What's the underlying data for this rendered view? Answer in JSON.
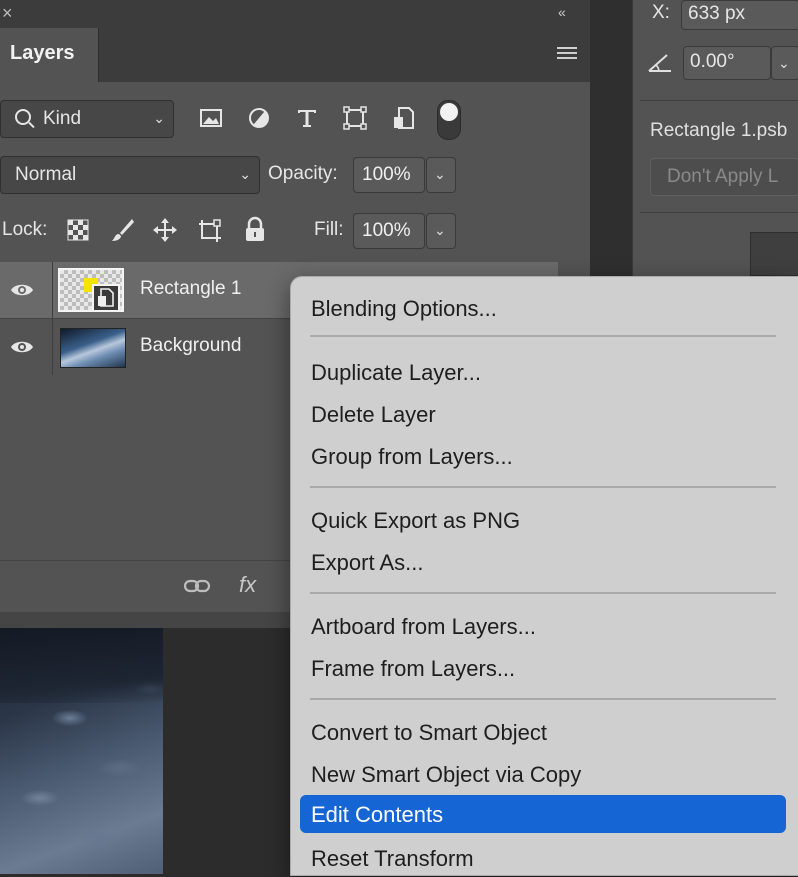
{
  "layers_panel": {
    "close_glyph": "×",
    "collapse_glyph": "«",
    "tab_title": "Layers",
    "filter_kind": "Kind",
    "blend_mode": "Normal",
    "opacity_label": "Opacity:",
    "opacity_value": "100%",
    "lock_label": "Lock:",
    "fill_label": "Fill:",
    "fill_value": "100%",
    "layers": [
      {
        "name": "Rectangle 1",
        "selected": true
      },
      {
        "name": "Background",
        "selected": false
      }
    ],
    "fx_label": "fx"
  },
  "properties_panel": {
    "x_label": "X:",
    "x_value": "633 px",
    "angle_value": "0.00°",
    "smart_object_name": "Rectangle 1.psb",
    "dont_apply_label": "Don't Apply L"
  },
  "context_menu": {
    "groups": [
      [
        "Blending Options..."
      ],
      [
        "Duplicate Layer...",
        "Delete Layer",
        "Group from Layers..."
      ],
      [
        "Quick Export as PNG",
        "Export As..."
      ],
      [
        "Artboard from Layers...",
        "Frame from Layers..."
      ],
      [
        "Convert to Smart Object",
        "New Smart Object via Copy",
        "Edit Contents",
        "Reset Transform"
      ]
    ],
    "highlighted_item": "Edit Contents",
    "highlight_color": "#1565d4"
  },
  "icons": [
    "close-icon",
    "collapse-icon",
    "panel-menu-icon",
    "search-icon",
    "image-filter-icon",
    "adjustment-filter-icon",
    "type-filter-icon",
    "shape-filter-icon",
    "smart-object-filter-icon",
    "filter-toggle-icon",
    "lock-transparent-icon",
    "lock-paint-icon",
    "lock-position-icon",
    "lock-artboard-icon",
    "lock-all-icon",
    "eye-icon",
    "link-icon",
    "fx-icon",
    "angle-icon"
  ]
}
